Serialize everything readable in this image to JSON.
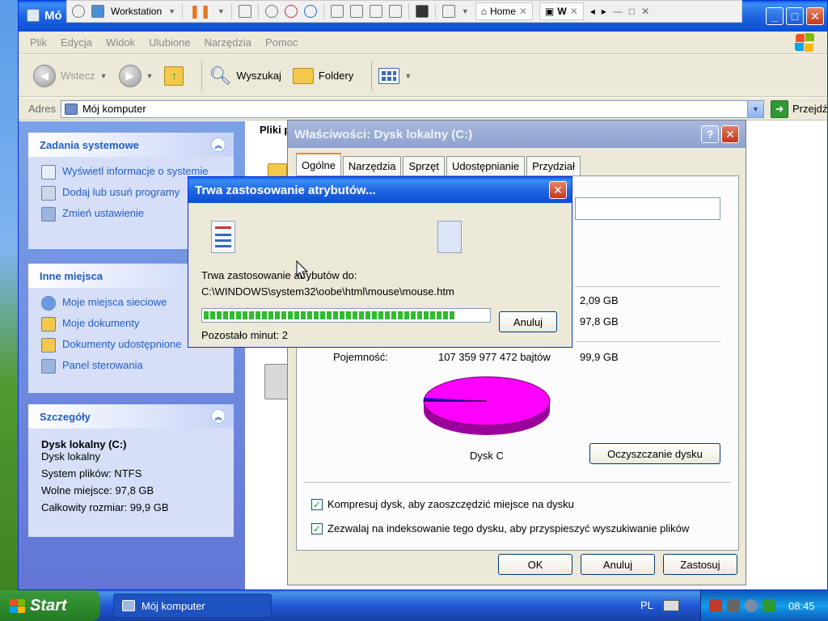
{
  "vmbar": {
    "vm_name": "Workstation",
    "tab_home": "Home",
    "tab_vm": "W"
  },
  "explorer": {
    "title": "Mó",
    "menu": [
      "Plik",
      "Edycja",
      "Widok",
      "Ulubione",
      "Narzędzia",
      "Pomoc"
    ],
    "toolbar": {
      "back": "Wstecz",
      "search": "Wyszukaj",
      "folders": "Foldery"
    },
    "address": {
      "label": "Adres",
      "value": "Mój komputer",
      "go": "Przejdź"
    },
    "files_header": "Pliki p"
  },
  "sidebar": {
    "system_tasks": {
      "title": "Zadania systemowe",
      "items": [
        "Wyświetl informacje o systemie",
        "Dodaj lub usuń programy",
        "Zmień ustawienie"
      ]
    },
    "other_places": {
      "title": "Inne miejsca",
      "items": [
        "Moje miejsca sieciowe",
        "Moje dokumenty",
        "Dokumenty udostępnione",
        "Panel sterowania"
      ]
    },
    "details": {
      "title": "Szczegóły",
      "name": "Dysk lokalny (C:)",
      "type": "Dysk lokalny",
      "fs": "System plików: NTFS",
      "free": "Wolne miejsce: 97,8 GB",
      "total": "Całkowity rozmiar: 99,9 GB"
    }
  },
  "props": {
    "title": "Właściwości: Dysk lokalny (C:)",
    "tabs": [
      "Ogólne",
      "Narzędzia",
      "Sprzęt",
      "Udostępnianie",
      "Przydział"
    ],
    "used_gb": "2,09 GB",
    "free_gb": "97,8 GB",
    "capacity_label": "Pojemność:",
    "capacity_bytes": "107 359 977 472 bajtów",
    "capacity_gb": "99,9 GB",
    "pie_label": "Dysk C",
    "cleanup_button": "Oczyszczanie dysku",
    "compress_label": "Kompresuj dysk, aby zaoszczędzić miejsce na dysku",
    "index_label": "Zezwalaj na indeksowanie tego dysku, aby przyspieszyć wyszukiwanie plików",
    "ok": "OK",
    "cancel": "Anuluj",
    "apply": "Zastosuj",
    "used_fraction": 0.021
  },
  "progress": {
    "title": "Trwa zastosowanie atrybutów...",
    "label": "Trwa zastosowanie atrybutów do:",
    "path": "C:\\WINDOWS\\system32\\oobe\\html\\mouse\\mouse.htm",
    "cancel": "Anuluj",
    "remaining": "Pozostało minut: 2",
    "percent": 88
  },
  "taskbar": {
    "start": "Start",
    "task": "Mój komputer",
    "lang": "PL",
    "clock": "08:45"
  }
}
